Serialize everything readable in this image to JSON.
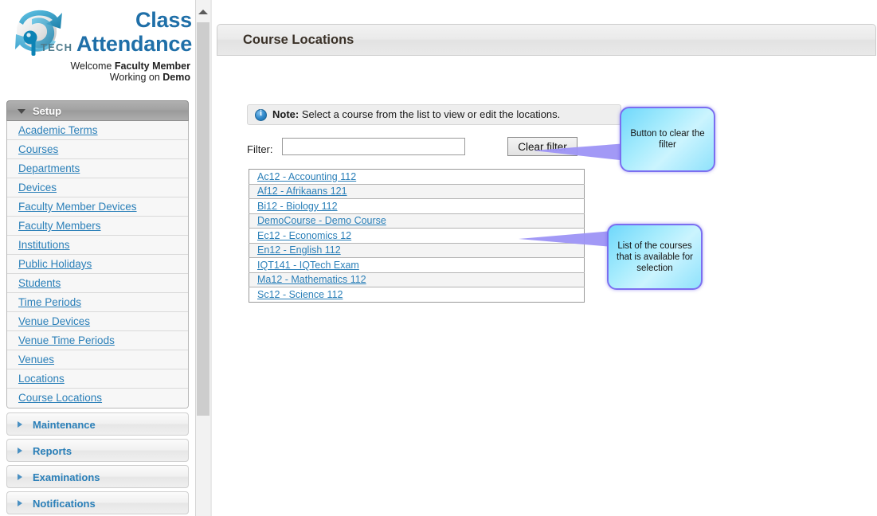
{
  "brand": {
    "logo_icon": "globe-swoosh-logo",
    "logo_text": "iQTECH",
    "title_line1": "Class",
    "title_line2": "Attendance",
    "welcome_prefix": "Welcome ",
    "welcome_role": "Faculty Member",
    "working_prefix": "Working on ",
    "working_target": "Demo",
    "accent_color": "#1f6fa8"
  },
  "sidebar": {
    "sections": [
      {
        "label": "Setup",
        "state": "open",
        "icon": "chevron-down-icon"
      },
      {
        "label": "Maintenance",
        "state": "closed",
        "icon": "chevron-right-icon"
      },
      {
        "label": "Reports",
        "state": "closed",
        "icon": "chevron-right-icon"
      },
      {
        "label": "Examinations",
        "state": "closed",
        "icon": "chevron-right-icon"
      },
      {
        "label": "Notifications",
        "state": "closed",
        "icon": "chevron-right-icon"
      }
    ],
    "setup_items": [
      {
        "label": "Academic Terms"
      },
      {
        "label": "Courses"
      },
      {
        "label": "Departments"
      },
      {
        "label": "Devices"
      },
      {
        "label": "Faculty Member Devices"
      },
      {
        "label": "Faculty Members"
      },
      {
        "label": "Institutions"
      },
      {
        "label": "Public Holidays"
      },
      {
        "label": "Students"
      },
      {
        "label": "Time Periods"
      },
      {
        "label": "Venue Devices"
      },
      {
        "label": "Venue Time Periods"
      },
      {
        "label": "Venues"
      },
      {
        "label": "Locations"
      },
      {
        "label": "Course Locations"
      }
    ],
    "link_color": "#2a7fb8",
    "scrollbar": {
      "up_arrow_icon": "chevron-up-icon"
    }
  },
  "page": {
    "title": "Course Locations",
    "note": {
      "icon": "info-icon",
      "bold_prefix": "Note:",
      "text": " Select a course from the list to view or edit the locations."
    },
    "filter": {
      "label": "Filter:",
      "value": "",
      "placeholder": "",
      "clear_button_label": "Clear filter"
    },
    "course_list": [
      {
        "label": "Ac12 - Accounting 112"
      },
      {
        "label": "Af12 - Afrikaans 121"
      },
      {
        "label": "Bi12 - Biology 112"
      },
      {
        "label": "DemoCourse - Demo Course"
      },
      {
        "label": "Ec12 - Economics 12"
      },
      {
        "label": "En12 - English 112"
      },
      {
        "label": "IQT141 - IQTech Exam"
      },
      {
        "label": "Ma12 - Mathematics 112"
      },
      {
        "label": "Sc12 - Science 112"
      }
    ]
  },
  "callouts": [
    {
      "text": "Button to clear the filter",
      "fill_color": "#8fe2fc",
      "border_color": "#7b6ef0"
    },
    {
      "text": "List of the courses that is available for selection",
      "fill_color": "#8fe2fc",
      "border_color": "#7b6ef0"
    }
  ]
}
